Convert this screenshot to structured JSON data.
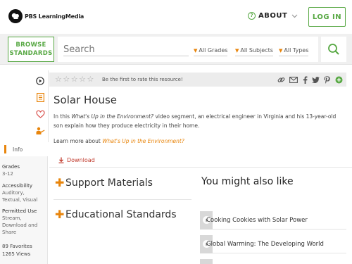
{
  "header": {
    "logo_text": "PBS LearningMedia",
    "about_label": "ABOUT",
    "login_label": "LOG IN"
  },
  "search": {
    "browse_line1": "BROWSE",
    "browse_line2": "STANDARDS",
    "placeholder": "Search",
    "filters": [
      "All Grades",
      "All Subjects",
      "All Types"
    ]
  },
  "rating": {
    "prompt": "Be the first to rate this resource!",
    "stars": 0,
    "max_stars": 5
  },
  "resource": {
    "title": "Solar House",
    "desc_before": "In this ",
    "desc_italic": "What's Up in the Environment?",
    "desc_after": " video segment, an electrical engineer in Virginia and his 13-year-old son explain how they produce electricity in their home.",
    "learn_prefix": "Learn more about ",
    "learn_link": "What's Up in the Environment?",
    "download_label": "Download"
  },
  "sidebar": {
    "info_tab": "Info",
    "grades_label": "Grades",
    "grades_value": "3-12",
    "accessibility_label": "Accessibility",
    "accessibility_value1": "Auditory,",
    "accessibility_value2": "Textual, Visual",
    "permitted_label": "Permitted Use",
    "permitted_value1": "Stream,",
    "permitted_value2": "Download and",
    "permitted_value3": "Share",
    "favorites": "89 Favorites",
    "views": "1265 Views"
  },
  "sections": {
    "support": "Support Materials",
    "standards": "Educational Standards"
  },
  "related": {
    "title": "You might also like",
    "items": [
      "Cooking Cookies with Solar Power",
      "Global Warming: The Developing World"
    ]
  },
  "colors": {
    "brand_green": "#57a843",
    "accent_orange": "#e8850c",
    "download_red": "#c0392b"
  }
}
